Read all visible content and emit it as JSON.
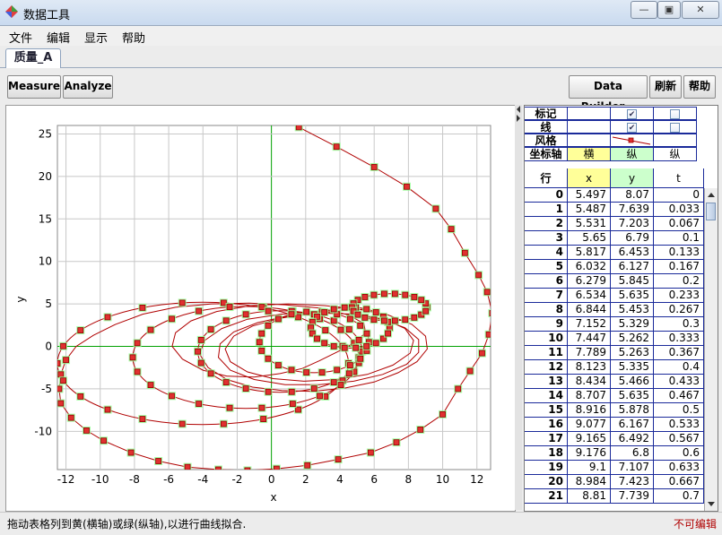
{
  "window": {
    "title": "数据工具",
    "min_icon": "minimize-icon",
    "max_icon": "maximize-icon",
    "close_icon": "close-icon"
  },
  "menu": [
    "文件",
    "编辑",
    "显示",
    "帮助"
  ],
  "tab": {
    "label": "质量_A"
  },
  "toolbar": {
    "measure": "Measure",
    "analyze": "Analyze",
    "data_builder": "Data Builder...",
    "refresh": "刷新",
    "help": "帮助"
  },
  "config": {
    "marker_label": "标记",
    "line_label": "线",
    "style_label": "风格",
    "axis_label": "坐标轴",
    "axis_values": [
      "横",
      "纵",
      "纵"
    ],
    "marker_checked": [
      true,
      false
    ],
    "line_checked": [
      true,
      false
    ]
  },
  "table": {
    "columns": [
      "行",
      "x",
      "y",
      "t"
    ],
    "rows": [
      [
        "0",
        "5.497",
        "8.07",
        "0"
      ],
      [
        "1",
        "5.487",
        "7.639",
        "0.033"
      ],
      [
        "2",
        "5.531",
        "7.203",
        "0.067"
      ],
      [
        "3",
        "5.65",
        "6.79",
        "0.1"
      ],
      [
        "4",
        "5.817",
        "6.453",
        "0.133"
      ],
      [
        "5",
        "6.032",
        "6.127",
        "0.167"
      ],
      [
        "6",
        "6.279",
        "5.845",
        "0.2"
      ],
      [
        "7",
        "6.534",
        "5.635",
        "0.233"
      ],
      [
        "8",
        "6.844",
        "5.453",
        "0.267"
      ],
      [
        "9",
        "7.152",
        "5.329",
        "0.3"
      ],
      [
        "10",
        "7.447",
        "5.262",
        "0.333"
      ],
      [
        "11",
        "7.789",
        "5.263",
        "0.367"
      ],
      [
        "12",
        "8.123",
        "5.335",
        "0.4"
      ],
      [
        "13",
        "8.434",
        "5.466",
        "0.433"
      ],
      [
        "14",
        "8.707",
        "5.635",
        "0.467"
      ],
      [
        "15",
        "8.916",
        "5.878",
        "0.5"
      ],
      [
        "16",
        "9.077",
        "6.167",
        "0.533"
      ],
      [
        "17",
        "9.165",
        "6.492",
        "0.567"
      ],
      [
        "18",
        "9.176",
        "6.8",
        "0.6"
      ],
      [
        "19",
        "9.1",
        "7.107",
        "0.633"
      ],
      [
        "20",
        "8.984",
        "7.423",
        "0.667"
      ],
      [
        "21",
        "8.81",
        "7.739",
        "0.7"
      ]
    ]
  },
  "colors": {
    "x_col_bg": "#ffff99",
    "y_col_bg": "#ccffcc",
    "axis_line": "#00a000",
    "series_line": "#b00000",
    "marker_fill": "#e03030",
    "marker_glow": "#99ff99",
    "status_readonly": "#b00000"
  },
  "chart_data": {
    "type": "scatter",
    "xlabel": "x",
    "ylabel": "y",
    "xlim": [
      -12.5,
      12.8
    ],
    "ylim": [
      -14.5,
      26
    ],
    "xticks": [
      -12,
      -10,
      -8,
      -6,
      -4,
      -2,
      0,
      2,
      4,
      6,
      8,
      10,
      12
    ],
    "yticks": [
      25,
      20,
      15,
      10,
      5,
      0,
      -5,
      -10
    ],
    "grid": true,
    "series": [
      {
        "points": [
          [
            1.6,
            25.8
          ],
          [
            3.8,
            23.5
          ],
          [
            6.0,
            21.1
          ],
          [
            7.9,
            18.8
          ],
          [
            9.6,
            16.2
          ],
          [
            10.5,
            13.8
          ],
          [
            11.3,
            11.0
          ],
          [
            12.1,
            8.4
          ],
          [
            12.6,
            6.4
          ],
          [
            12.9,
            3.9
          ],
          [
            12.7,
            1.4
          ],
          [
            12.3,
            -0.8
          ],
          [
            11.6,
            -2.9
          ],
          [
            10.9,
            -5.0
          ],
          [
            10.0,
            -8.0
          ],
          [
            8.7,
            -9.8
          ],
          [
            7.3,
            -11.3
          ],
          [
            5.8,
            -12.5
          ],
          [
            3.9,
            -13.3
          ],
          [
            2.1,
            -14.0
          ],
          [
            0.3,
            -14.4
          ],
          [
            -1.4,
            -14.6
          ],
          [
            -3.1,
            -14.5
          ],
          [
            -4.9,
            -14.2
          ],
          [
            -6.6,
            -13.5
          ],
          [
            -8.2,
            -12.5
          ],
          [
            -9.8,
            -11.1
          ],
          [
            -10.8,
            -9.9
          ],
          [
            -11.7,
            -8.4
          ],
          [
            -12.3,
            -6.7
          ],
          [
            -12.4,
            -5.0
          ],
          [
            -12.3,
            -3.3
          ],
          [
            -12.0,
            -1.6
          ],
          [
            -11.4,
            0.0
          ],
          [
            -10.4,
            1.3
          ],
          [
            -9.1,
            2.6
          ],
          [
            -7.5,
            3.8
          ],
          [
            -5.6,
            4.6
          ],
          [
            -3.5,
            5.0
          ],
          [
            -1.3,
            5.1
          ],
          [
            0.8,
            4.9
          ],
          [
            2.9,
            4.5
          ],
          [
            4.5,
            3.7
          ],
          [
            5.4,
            2.7
          ],
          [
            5.5,
            1.6
          ],
          [
            4.9,
            0.5
          ],
          [
            3.9,
            -0.6
          ],
          [
            2.8,
            -1.7
          ],
          [
            1.8,
            -2.6
          ],
          [
            0.5,
            -3.2
          ],
          [
            -1.0,
            -3.6
          ],
          [
            -2.6,
            -3.5
          ],
          [
            -4.0,
            -2.8
          ],
          [
            -5.2,
            -1.5
          ],
          [
            -5.8,
            0.0
          ],
          [
            -5.6,
            1.6
          ],
          [
            -4.7,
            3.0
          ],
          [
            -3.2,
            4.1
          ],
          [
            -1.2,
            4.8
          ],
          [
            1.0,
            5.0
          ],
          [
            3.1,
            4.8
          ],
          [
            5.0,
            4.4
          ],
          [
            6.8,
            3.7
          ],
          [
            8.2,
            2.6
          ],
          [
            9.0,
            1.2
          ],
          [
            9.1,
            -0.3
          ],
          [
            8.5,
            -1.8
          ],
          [
            7.4,
            -3.1
          ],
          [
            6.0,
            -4.2
          ],
          [
            4.3,
            -4.9
          ],
          [
            2.4,
            -5.3
          ],
          [
            0.6,
            -5.2
          ],
          [
            -1.1,
            -4.8
          ],
          [
            -2.6,
            -3.9
          ],
          [
            -3.7,
            -2.5
          ],
          [
            -4.2,
            -0.9
          ],
          [
            -3.9,
            0.7
          ],
          [
            -2.9,
            2.1
          ],
          [
            -1.4,
            3.2
          ],
          [
            0.6,
            3.8
          ],
          [
            2.6,
            4.0
          ],
          [
            4.6,
            3.8
          ],
          [
            6.4,
            3.2
          ],
          [
            7.8,
            2.2
          ],
          [
            8.6,
            0.8
          ],
          [
            8.6,
            -0.7
          ],
          [
            7.9,
            -2.1
          ],
          [
            6.5,
            -3.3
          ],
          [
            4.8,
            -4.1
          ],
          [
            2.8,
            -4.5
          ],
          [
            0.8,
            -4.5
          ],
          [
            -1.0,
            -3.9
          ],
          [
            -2.4,
            -2.8
          ],
          [
            -3.1,
            -1.3
          ],
          [
            -3.0,
            0.3
          ],
          [
            -2.2,
            1.7
          ],
          [
            -0.8,
            2.8
          ],
          [
            1.0,
            3.6
          ],
          [
            3.0,
            3.9
          ],
          [
            4.9,
            3.8
          ],
          [
            6.6,
            3.2
          ],
          [
            7.8,
            2.1
          ],
          [
            8.3,
            0.7
          ],
          [
            8.1,
            -0.8
          ],
          [
            7.1,
            -2.2
          ],
          [
            5.6,
            -3.3
          ],
          [
            3.8,
            -3.9
          ],
          [
            1.9,
            -4.1
          ],
          [
            0.1,
            -3.8
          ],
          [
            -1.4,
            -3.0
          ],
          [
            -2.4,
            -1.8
          ],
          [
            -2.7,
            -0.3
          ],
          [
            -2.2,
            1.2
          ],
          [
            -1.1,
            2.4
          ],
          [
            0.5,
            3.3
          ],
          [
            2.3,
            3.9
          ],
          [
            4.1,
            4.2
          ],
          [
            5.6,
            4.4
          ]
        ]
      }
    ],
    "ellipses": [
      {
        "cx": -4.0,
        "cy": -2.0,
        "rx": 8.5,
        "ry": 7.2
      },
      {
        "cx": -1.5,
        "cy": -1.3,
        "rx": 6.6,
        "ry": 6.0
      },
      {
        "cx": 0.5,
        "cy": -0.6,
        "rx": 4.8,
        "ry": 4.8
      },
      {
        "cx": 2.5,
        "cy": 0.5,
        "rx": 3.2,
        "ry": 3.6
      },
      {
        "cx": 4.6,
        "cy": 2.2,
        "rx": 2.3,
        "ry": 2.4
      },
      {
        "cx": 6.9,
        "cy": 4.6,
        "rx": 2.2,
        "ry": 1.6
      }
    ]
  },
  "status": {
    "message": "拖动表格列到黄(横轴)或绿(纵轴),以进行曲线拟合.",
    "readonly": "不可编辑"
  }
}
